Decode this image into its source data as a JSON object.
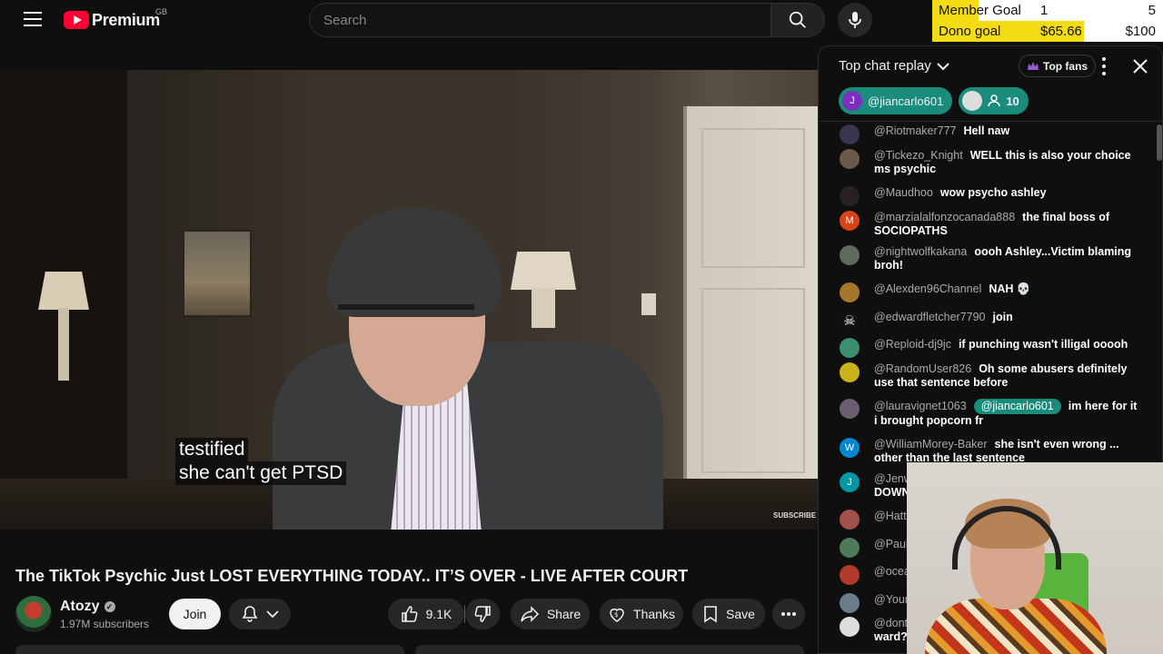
{
  "topbar": {
    "logo_text": "Premium",
    "region": "GB",
    "search_placeholder": "Search"
  },
  "goals": {
    "member": {
      "label": "Member Goal",
      "current": "1",
      "target": "5",
      "progress": 0.2
    },
    "dono": {
      "label": "Dono goal",
      "current": "$65.66",
      "target": "$100",
      "progress": 0.6566
    }
  },
  "video": {
    "subtitle_line1": "testified",
    "subtitle_line2": "she can't get PTSD",
    "watermark": "SUBSCRIBE"
  },
  "meta": {
    "title": "The TikTok Psychic Just LOST EVERYTHING TODAY.. IT’S OVER - LIVE AFTER COURT",
    "channel": "Atozy",
    "subscribers": "1.97M subscribers",
    "join": "Join",
    "likes": "9.1K",
    "share": "Share",
    "thanks": "Thanks",
    "save": "Save"
  },
  "chat": {
    "title": "Top chat replay",
    "top_fans": "Top fans",
    "pinned_user": "@jiancarlo601",
    "pinned_count": "10",
    "pinned_initial": "J",
    "messages": [
      {
        "author": "@Riotmaker777",
        "text": "Hell naw",
        "initial": "",
        "color": "#3a3550"
      },
      {
        "author": "@Tickezo_Knight",
        "text": "WELL this is also your choice ms psychic",
        "initial": "",
        "color": "#6b5a4a"
      },
      {
        "author": "@Maudhoo",
        "text": "wow psycho ashley",
        "initial": "",
        "color": "#2a1f24"
      },
      {
        "author": "@marzialalfonzocanada888",
        "text": "the final boss of SOCIOPATHS",
        "initial": "M",
        "color": "#d84315"
      },
      {
        "author": "@nightwolfkakana",
        "text": "oooh Ashley...Victim blaming broh!",
        "initial": "",
        "color": "#5d6b5a"
      },
      {
        "author": "@Alexden96Channel",
        "text": "NAH 💀",
        "initial": "",
        "color": "#a5772b"
      },
      {
        "author": "@edwardfletcher7790",
        "text": "join",
        "initial": "☠",
        "color": "#111111"
      },
      {
        "author": "@Reploid-dj9jc",
        "text": "if punching wasn't illigal ooooh",
        "initial": "",
        "color": "#3c8f6f"
      },
      {
        "author": "@RandomUser826",
        "text": "Oh some abusers definitely use that sentence before",
        "initial": "",
        "color": "#c9b21a"
      },
      {
        "author": "@lauravignet1063",
        "mention": "@jiancarlo601",
        "text": "im here for it i brought popcorn fr",
        "initial": "",
        "color": "#6a5f70"
      },
      {
        "author": "@WilliamMorey-Baker",
        "text": "she isn't even wrong ... other than the last sentence",
        "initial": "W",
        "color": "#0288d1"
      },
      {
        "author": "@Jenw",
        "text": "DOWN",
        "initial": "J",
        "color": "#0097a7"
      },
      {
        "author": "@Hatty",
        "text": "",
        "initial": "",
        "color": "#a0524a"
      },
      {
        "author": "@Paul",
        "text": "",
        "initial": "",
        "color": "#4f7a5a"
      },
      {
        "author": "@ocea",
        "text": "",
        "initial": "",
        "color": "#b23a2a"
      },
      {
        "author": "@Your",
        "text": "",
        "initial": "",
        "color": "#6b7b8a"
      },
      {
        "author": "@dont",
        "text": "ward?",
        "initial": "",
        "color": "#dddddd"
      }
    ]
  }
}
